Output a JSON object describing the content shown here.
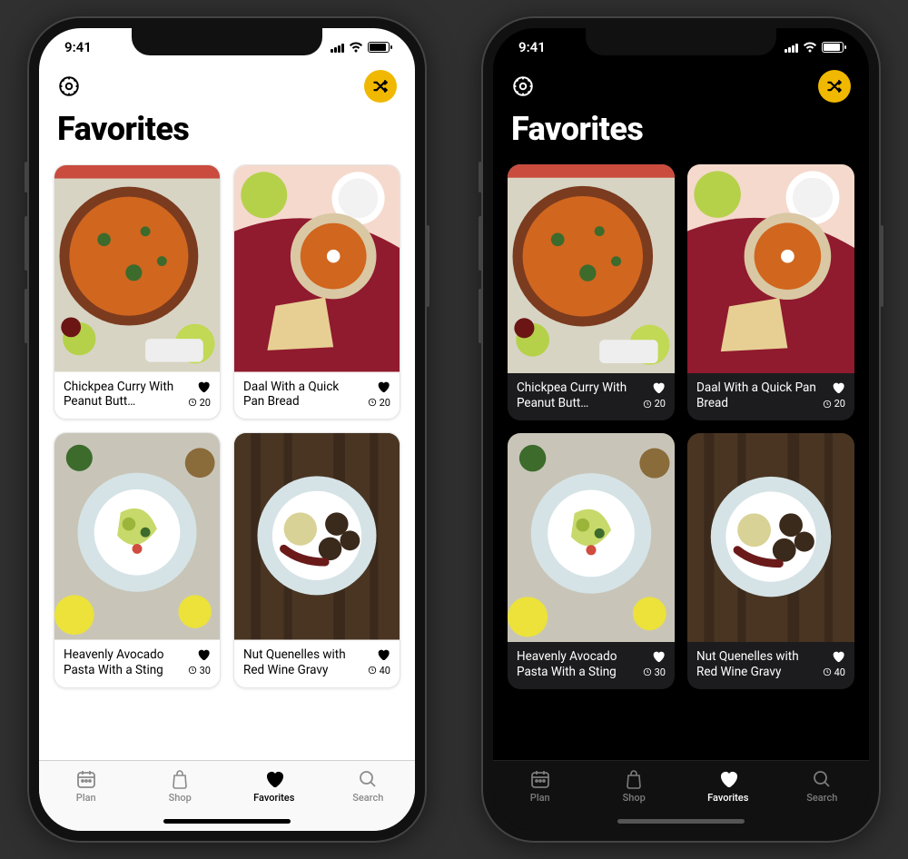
{
  "status": {
    "time": "9:41"
  },
  "page_title": "Favorites",
  "colors": {
    "accent": "#f0b800"
  },
  "recipes": [
    {
      "title": "Chickpea Curry With Peanut Butt…",
      "minutes": 20,
      "favorite": true
    },
    {
      "title": "Daal With a Quick Pan Bread",
      "minutes": 20,
      "favorite": true
    },
    {
      "title": "Heavenly Avocado Pasta With a Sting",
      "minutes": 30,
      "favorite": true
    },
    {
      "title": "Nut Quenelles with Red Wine Gravy",
      "minutes": 40,
      "favorite": true
    }
  ],
  "tabs": [
    {
      "label": "Plan",
      "icon": "calendar-icon",
      "active": false
    },
    {
      "label": "Shop",
      "icon": "bag-icon",
      "active": false
    },
    {
      "label": "Favorites",
      "icon": "heart-icon",
      "active": true
    },
    {
      "label": "Search",
      "icon": "search-icon",
      "active": false
    }
  ]
}
